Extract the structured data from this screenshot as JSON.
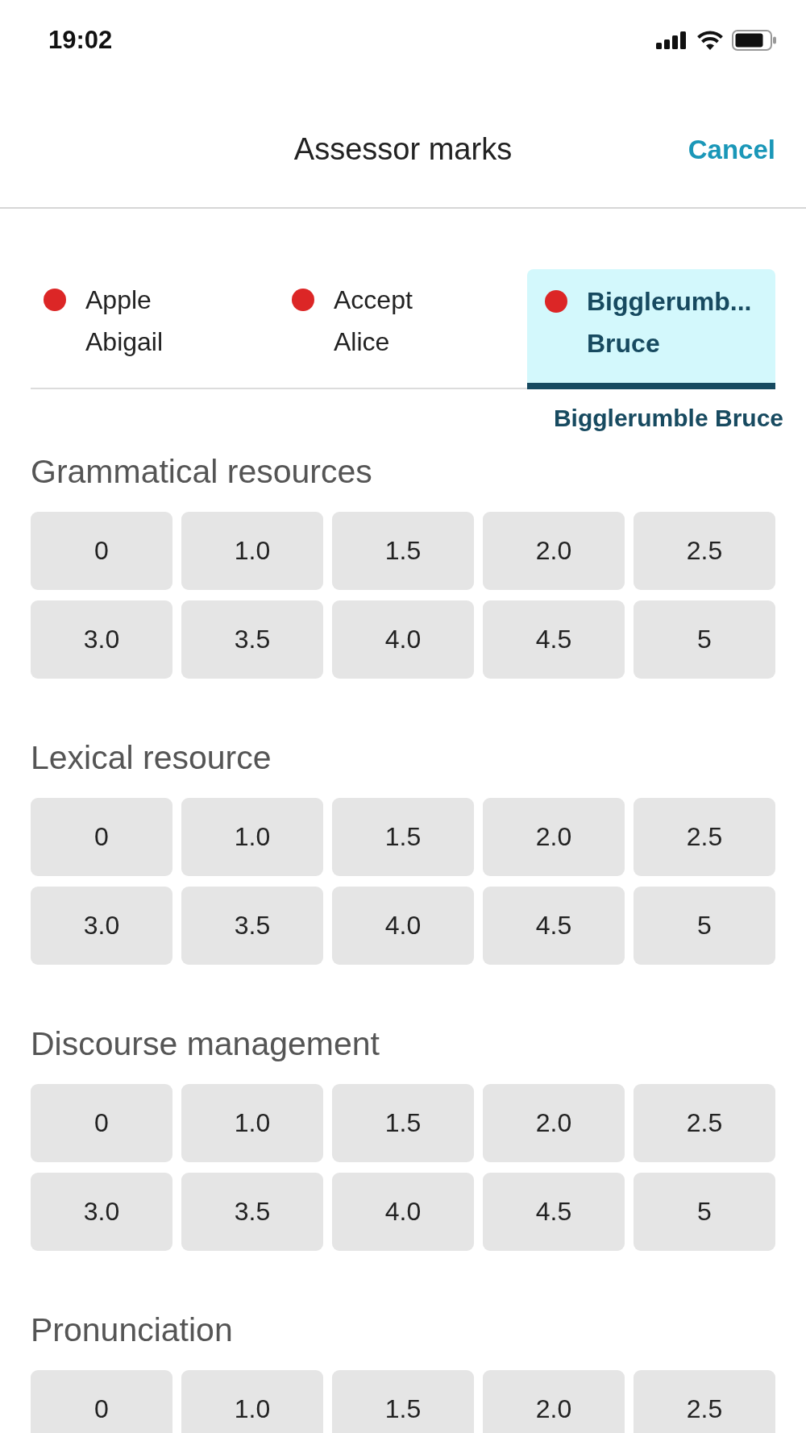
{
  "status_bar": {
    "time": "19:02"
  },
  "header": {
    "title": "Assessor marks",
    "cancel": "Cancel"
  },
  "tabs": [
    {
      "label": "Apple Abigail",
      "selected": false
    },
    {
      "label": "Accept Alice",
      "selected": false
    },
    {
      "label": "Bigglerumb... Bruce",
      "selected": true
    }
  ],
  "selected_name": "Bigglerumble Bruce",
  "criteria": [
    {
      "title": "Grammatical resources",
      "scores": [
        "0",
        "1.0",
        "1.5",
        "2.0",
        "2.5",
        "3.0",
        "3.5",
        "4.0",
        "4.5",
        "5"
      ]
    },
    {
      "title": "Lexical resource",
      "scores": [
        "0",
        "1.0",
        "1.5",
        "2.0",
        "2.5",
        "3.0",
        "3.5",
        "4.0",
        "4.5",
        "5"
      ]
    },
    {
      "title": "Discourse management",
      "scores": [
        "0",
        "1.0",
        "1.5",
        "2.0",
        "2.5",
        "3.0",
        "3.5",
        "4.0",
        "4.5",
        "5"
      ]
    },
    {
      "title": "Pronunciation",
      "scores": [
        "0",
        "1.0",
        "1.5",
        "2.0",
        "2.5"
      ]
    }
  ]
}
